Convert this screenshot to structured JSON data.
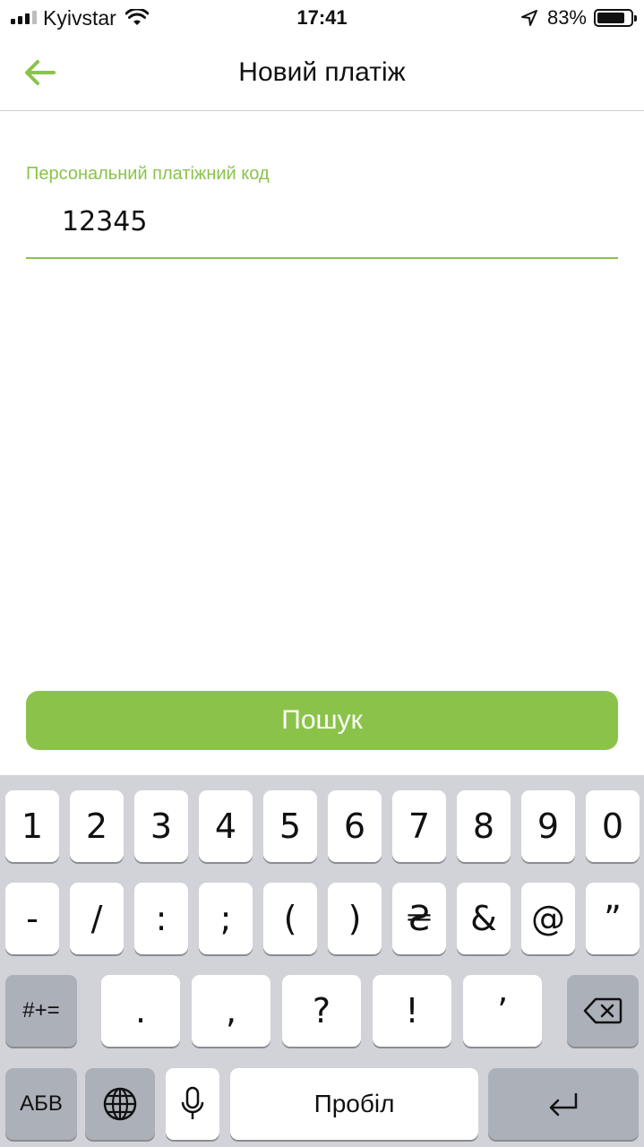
{
  "status_bar": {
    "carrier": "Kyivstar",
    "time": "17:41",
    "battery_percent": "83%",
    "battery_level": 0.83,
    "signal_bars": 3
  },
  "header": {
    "title": "Новий платіж",
    "back_icon": "arrow-left-icon"
  },
  "form": {
    "label": "Персональний платіжний код",
    "value": "12345"
  },
  "search_button": {
    "label": "Пошук"
  },
  "colors": {
    "accent": "#8bc34a",
    "keyboard_bg": "#d1d3d9"
  },
  "keyboard": {
    "row1": [
      "1",
      "2",
      "3",
      "4",
      "5",
      "6",
      "7",
      "8",
      "9",
      "0"
    ],
    "row2": [
      "-",
      "/",
      ":",
      ";",
      "(",
      ")",
      "₴",
      "&",
      "@",
      "”"
    ],
    "row3": [
      "#+=",
      ".",
      ",",
      "?",
      "!",
      "’"
    ],
    "row4": {
      "lang": "АБВ",
      "globe_icon": "globe-icon",
      "mic_icon": "microphone-icon",
      "space": "Пробіл",
      "return_icon": "return-icon"
    },
    "backspace_icon": "backspace-icon"
  }
}
